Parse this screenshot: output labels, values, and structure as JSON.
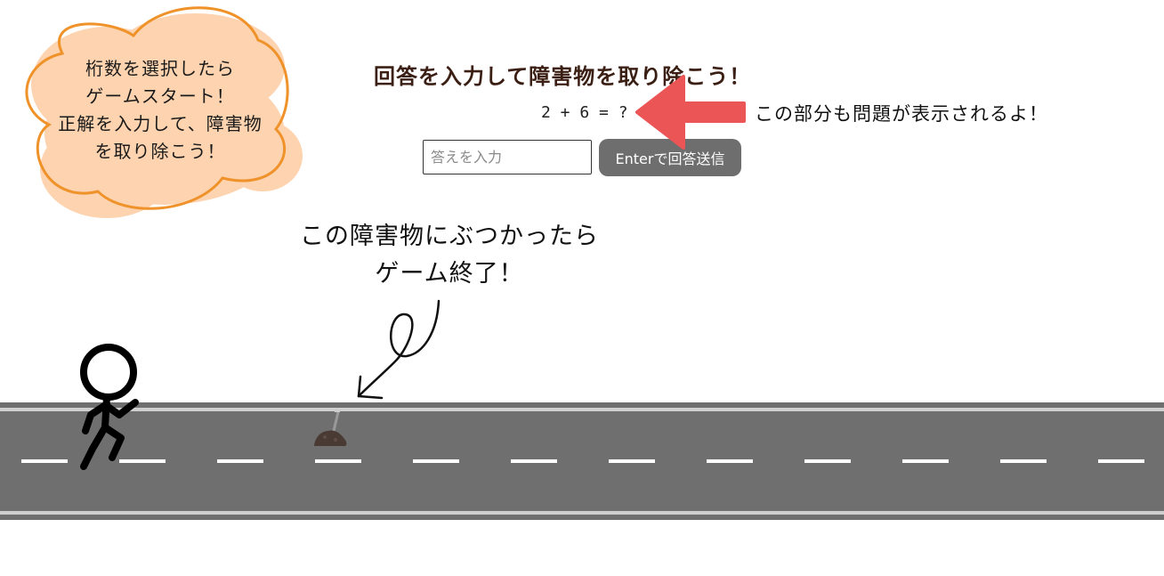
{
  "hint_cloud": {
    "lines": [
      "桁数を選択したら",
      "ゲームスタート！",
      "正解を入力して、障害物",
      "を取り除こう！"
    ]
  },
  "game": {
    "title": "回答を入力して障害物を取り除こう！",
    "question": "2 + 6 = ?",
    "answer_input": {
      "placeholder": "答えを入力",
      "value": ""
    },
    "submit_label": "Enterで回答送信"
  },
  "annotations": {
    "question_note": "この部分も問題が表示されるよ！",
    "obstacle_note": [
      "この障害物にぶつかったら",
      "ゲーム終了！"
    ]
  },
  "colors": {
    "cloud_fill": "#fdd3b0",
    "cloud_stroke": "#f0922a",
    "title": "#3b1f14",
    "arrow": "#ec5555",
    "button_bg": "#6e6e6e",
    "road": "#6f6f6f",
    "road_edge": "#bdbdbd",
    "lane_mark": "#ffffff"
  },
  "icons": {
    "runner": "stick-figure-runner-icon",
    "obstacle": "dirt-pile-with-shovel-icon",
    "pointer": "red-arrow-left-icon"
  }
}
